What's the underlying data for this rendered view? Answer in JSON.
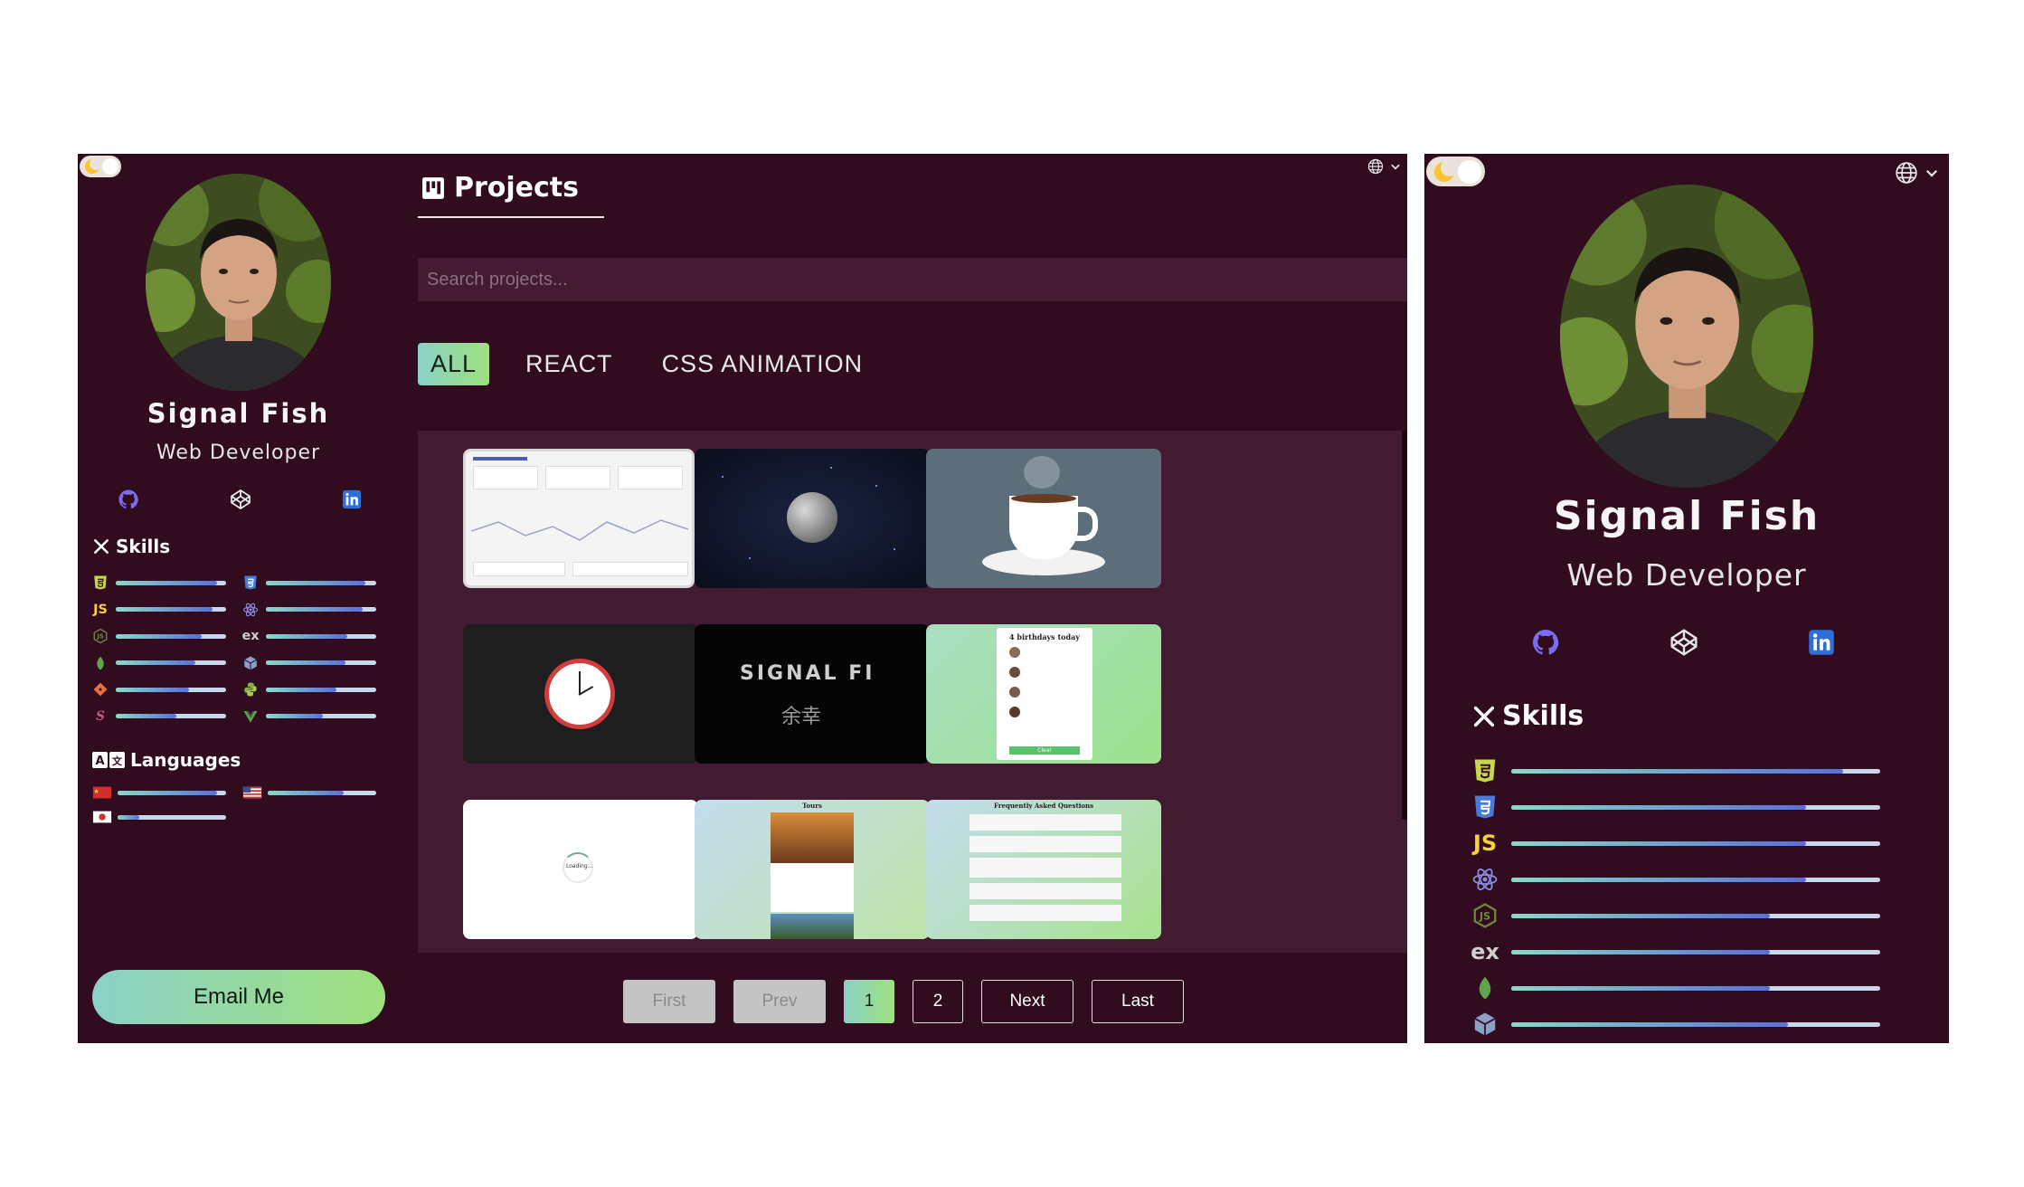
{
  "profile": {
    "name": "Signal Fish",
    "role": "Web Developer"
  },
  "skills_title": "Skills",
  "languages_title": "Languages",
  "email_button": "Email Me",
  "skills_desktop": [
    {
      "icon": "html5-icon",
      "level": 0.92
    },
    {
      "icon": "css3-icon",
      "level": 0.9
    },
    {
      "icon": "javascript-icon",
      "text": "JS",
      "level": 0.88
    },
    {
      "icon": "react-icon",
      "level": 0.88
    },
    {
      "icon": "nodejs-icon",
      "level": 0.78
    },
    {
      "icon": "express-icon",
      "text": "ex",
      "level": 0.74
    },
    {
      "icon": "mongodb-icon",
      "level": 0.72
    },
    {
      "icon": "package-icon",
      "level": 0.72
    },
    {
      "icon": "git-icon",
      "level": 0.66
    },
    {
      "icon": "python-icon",
      "level": 0.64
    },
    {
      "icon": "sass-icon",
      "level": 0.55
    },
    {
      "icon": "vue-icon",
      "level": 0.52
    }
  ],
  "languages": [
    {
      "icon": "china-flag-icon",
      "level": 0.92
    },
    {
      "icon": "usa-flag-icon",
      "level": 0.7
    },
    {
      "icon": "japan-flag-icon",
      "level": 0.2
    }
  ],
  "skills_mobile": [
    {
      "icon": "html5-icon",
      "level": 0.9
    },
    {
      "icon": "css3-icon",
      "level": 0.8
    },
    {
      "icon": "javascript-icon",
      "text": "JS",
      "level": 0.8
    },
    {
      "icon": "react-icon",
      "level": 0.8
    },
    {
      "icon": "nodejs-icon",
      "level": 0.7
    },
    {
      "icon": "express-icon",
      "text": "ex",
      "level": 0.7
    },
    {
      "icon": "mongodb-icon",
      "level": 0.7
    },
    {
      "icon": "package-icon",
      "level": 0.75
    }
  ],
  "projects": {
    "title": "Projects",
    "search_placeholder": "Search projects...",
    "filters": [
      {
        "label": "ALL",
        "active": true
      },
      {
        "label": "REACT",
        "active": false
      },
      {
        "label": "CSS ANIMATION",
        "active": false
      }
    ],
    "cards": [
      {
        "id": "admin-dashboard"
      },
      {
        "id": "moon-night"
      },
      {
        "id": "coffee-cup"
      },
      {
        "id": "clock"
      },
      {
        "id": "signal-fish-text",
        "text_a": "SIGNAL FI",
        "text_b": "余幸"
      },
      {
        "id": "birthday-reminder",
        "heading": "4 birthdays today",
        "button": "Clear"
      },
      {
        "id": "loading",
        "text": "Loading..."
      },
      {
        "id": "tours",
        "heading": "Tours"
      },
      {
        "id": "faq",
        "heading": "Frequently Asked Questions"
      }
    ],
    "pagination": [
      {
        "label": "First",
        "state": "disabled"
      },
      {
        "label": "Prev",
        "state": "disabled"
      },
      {
        "label": "1",
        "state": "active"
      },
      {
        "label": "2",
        "state": "normal"
      },
      {
        "label": "Next",
        "state": "normal"
      },
      {
        "label": "Last",
        "state": "normal"
      }
    ]
  },
  "colors": {
    "background": "#310b1e",
    "accent_gradient_start": "#8bd1c8",
    "accent_gradient_end": "#9ee07c",
    "bar_fill": "#5c6fd6",
    "bar_track": "#c9d7ec"
  }
}
